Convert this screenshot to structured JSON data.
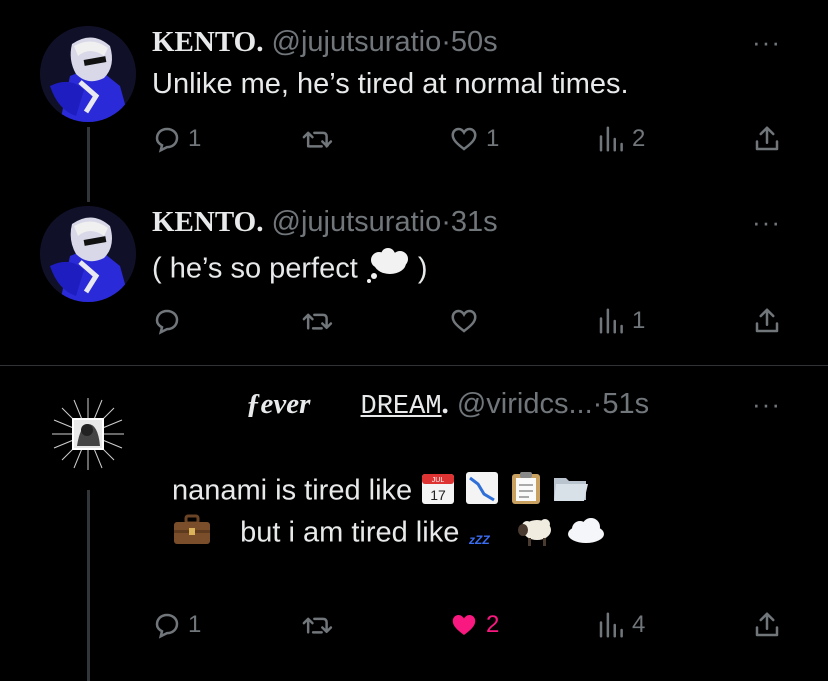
{
  "tweets": [
    {
      "display_name": "KENTO.",
      "handle": "@jujutsuratio",
      "dot": "·",
      "time": "50s",
      "text": "Unlike me, he’s tired at normal times.",
      "replies": "1",
      "retweets": "",
      "likes": "1",
      "views": "2",
      "liked": false
    },
    {
      "display_name": "KENTO.",
      "handle": "@jujutsuratio",
      "dot": "·",
      "time": "31s",
      "text_pre": "( he’s so perfect",
      "text_post": ")",
      "replies": "",
      "retweets": "",
      "likes": "",
      "views": "1",
      "liked": false
    },
    {
      "display_name_part1": "ƒever",
      "display_name_part2": "DREAM",
      "display_name_part3": ".",
      "handle": "@viridcs...",
      "dot": "·",
      "time": "51s",
      "line1": "nanami is tired like",
      "line2": "but i am tired like",
      "replies": "1",
      "retweets": "",
      "likes": "2",
      "views": "4",
      "liked": true
    }
  ],
  "more_label": "···",
  "colors": {
    "muted": "#71767b",
    "like_active": "#f91880",
    "text": "#e7e9ea",
    "zzz": "#3b6df0"
  },
  "icons": [
    "reply-icon",
    "retweet-icon",
    "heart-icon",
    "views-icon",
    "share-icon",
    "more-icon",
    "calendar-emoji",
    "chart-down-emoji",
    "clipboard-emoji",
    "folder-emoji",
    "briefcase-emoji",
    "zzz-emoji",
    "sheep-emoji",
    "cloud-emoji",
    "thought-balloon-emoji"
  ],
  "emoji_text": {
    "calendar_month": "JUL",
    "calendar_day": "17",
    "zzz": "zZZ"
  }
}
